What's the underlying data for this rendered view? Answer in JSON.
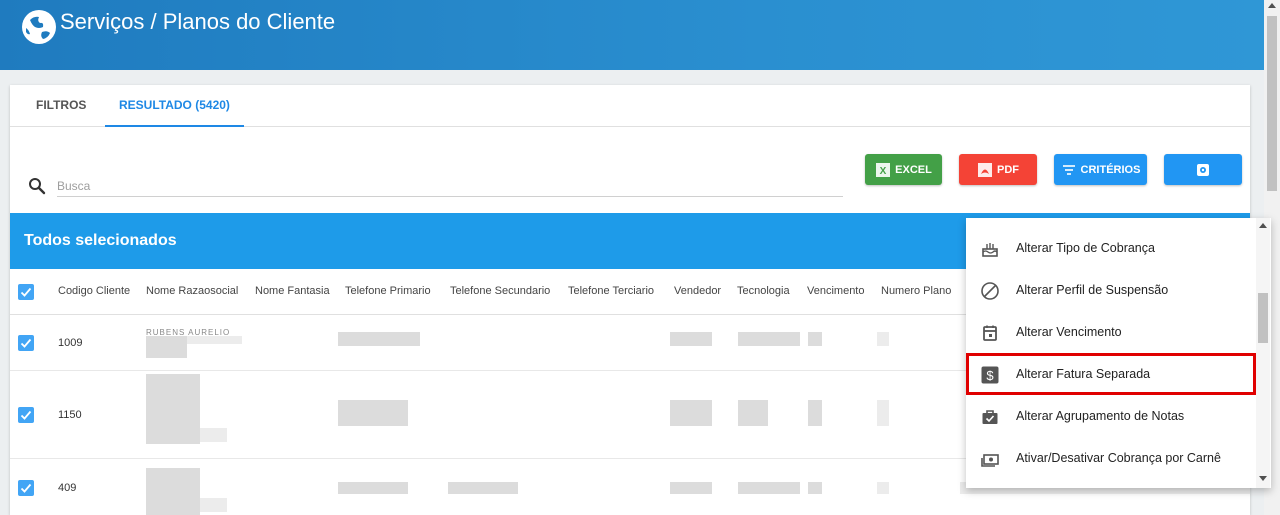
{
  "app": {
    "title": "Serviços / Planos do Cliente"
  },
  "tabs": [
    {
      "label": "FILTROS"
    },
    {
      "label": "RESULTADO (5420)"
    }
  ],
  "search": {
    "placeholder": "Busca",
    "value": ""
  },
  "toolbar": {
    "excel_label": "EXCEL",
    "pdf_label": "PDF",
    "criteria_label": "CRITÉRIOS"
  },
  "selection": {
    "title": "Todos selecionados"
  },
  "table": {
    "columns": [
      "Codigo Cliente",
      "Nome Razaosocial",
      "Nome Fantasia",
      "Telefone Primario",
      "Telefone Secundario",
      "Telefone Terciario",
      "Vendedor",
      "Tecnologia",
      "Vencimento",
      "Numero Plano"
    ],
    "rows": [
      {
        "codigo": "1009",
        "partial_name": "RUBENS AURELIO"
      },
      {
        "codigo": "1150"
      },
      {
        "codigo": "409"
      }
    ]
  },
  "menu": {
    "items": [
      {
        "label": "Alterar Tipo de Cobrança",
        "icon": "cake-icon"
      },
      {
        "label": "Alterar Perfil de Suspensão",
        "icon": "block-icon"
      },
      {
        "label": "Alterar Vencimento",
        "icon": "calendar-icon"
      },
      {
        "label": "Alterar Fatura Separada",
        "icon": "dollar-icon",
        "highlighted": true
      },
      {
        "label": "Alterar Agrupamento de Notas",
        "icon": "briefcase-check-icon"
      },
      {
        "label": "Ativar/Desativar Cobrança por Carnê",
        "icon": "money-icon"
      }
    ]
  },
  "colors": {
    "header": "#1f7bbf",
    "accent": "#1e88e5",
    "selection_bar": "#1e9be9",
    "excel": "#43a047",
    "pdf": "#f44336",
    "highlight": "#e00000"
  }
}
